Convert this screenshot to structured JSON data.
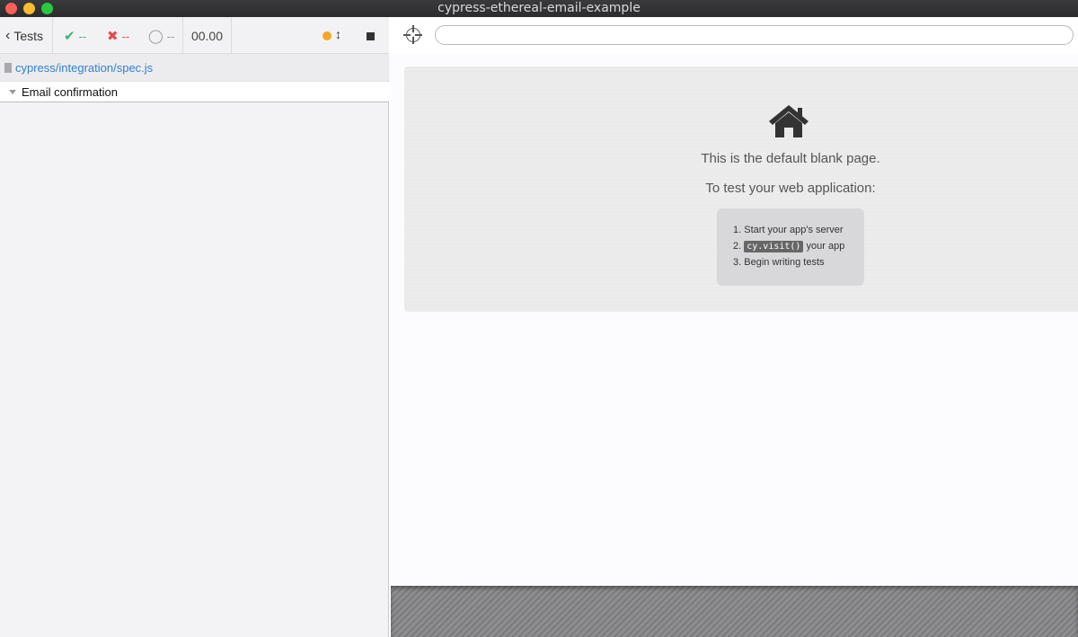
{
  "window": {
    "title": "cypress-ethereal-email-example"
  },
  "reporter": {
    "back_label": "Tests",
    "stats": {
      "passed": "--",
      "failed": "--",
      "pending": "--"
    },
    "duration": "00.00",
    "spec_path": "cypress/integration/spec.js",
    "suite_title": "Email confirmation"
  },
  "app": {
    "url": "",
    "blank_title": "This is the default blank page.",
    "blank_subtitle": "To test your web application:",
    "steps": [
      {
        "num": "1.",
        "text": "Start your app's server"
      },
      {
        "num": "2.",
        "code": "cy.visit()",
        "text": "your app"
      },
      {
        "num": "3.",
        "text": "Begin writing tests"
      }
    ]
  },
  "colors": {
    "passed": "#3cb371",
    "failed": "#e14c4c",
    "running_dot": "#f5a623",
    "link": "#3380d0"
  },
  "icons": [
    "close-window-icon",
    "minimize-window-icon",
    "zoom-window-icon",
    "chevron-left-icon",
    "check-icon",
    "x-icon",
    "circle-pending-icon",
    "status-dot-icon",
    "up-down-arrow-icon",
    "stop-icon",
    "file-icon",
    "caret-down-icon",
    "crosshair-icon",
    "home-icon"
  ]
}
